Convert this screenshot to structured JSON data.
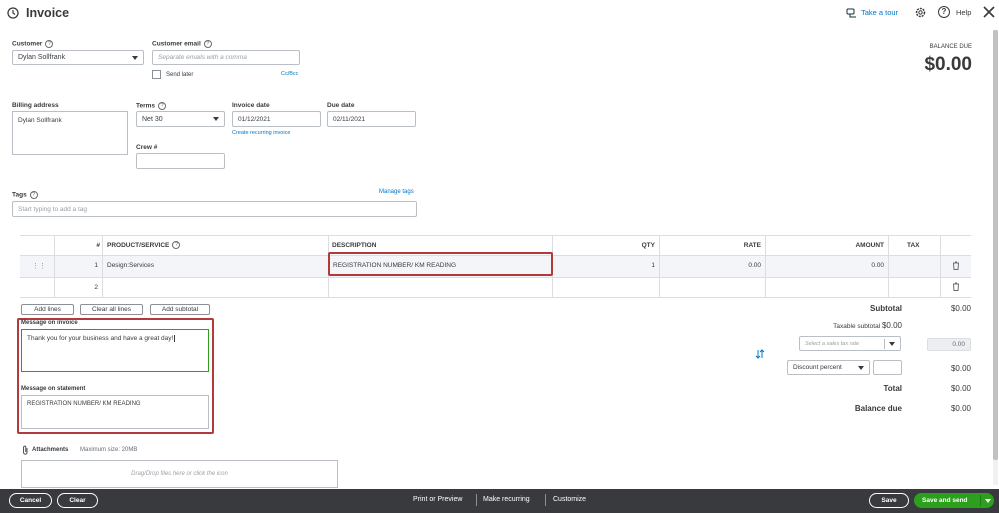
{
  "header": {
    "title": "Invoice",
    "take_tour": "Take a tour",
    "help": "Help"
  },
  "customer": {
    "label": "Customer",
    "value": "Dylan Sollfrank"
  },
  "email": {
    "label": "Customer email",
    "placeholder": "Separate emails with a comma",
    "send_later": "Send later",
    "cc_bcc": "Cc/Bcc"
  },
  "balance": {
    "label": "BALANCE DUE",
    "value": "$0.00"
  },
  "billing": {
    "label": "Billing address",
    "value": "Dylan Sollfrank"
  },
  "terms": {
    "label": "Terms",
    "value": "Net 30"
  },
  "invoice_date": {
    "label": "Invoice date",
    "value": "01/12/2021",
    "recurring_link": "Create recurring invoice"
  },
  "due_date": {
    "label": "Due date",
    "value": "02/11/2021"
  },
  "crew": {
    "label": "Crew #",
    "value": ""
  },
  "tags": {
    "label": "Tags",
    "manage": "Manage tags",
    "placeholder": "Start typing to add a tag"
  },
  "table": {
    "headers": {
      "num": "#",
      "product": "PRODUCT/SERVICE",
      "description": "DESCRIPTION",
      "qty": "QTY",
      "rate": "RATE",
      "amount": "AMOUNT",
      "tax": "TAX"
    },
    "rows": [
      {
        "num": "1",
        "product": "Design:Services",
        "description": "REGISTRATION NUMBER/ KM READING",
        "qty": "1",
        "rate": "0.00",
        "amount": "0.00"
      },
      {
        "num": "2",
        "product": "",
        "description": "",
        "qty": "",
        "rate": "",
        "amount": ""
      }
    ]
  },
  "line_buttons": {
    "add": "Add lines",
    "clear": "Clear all lines",
    "subtotal": "Add subtotal"
  },
  "message_invoice": {
    "label": "Message on invoice",
    "value": "Thank you for your business and have a great day!"
  },
  "message_statement": {
    "label": "Message on statement",
    "value": "REGISTRATION NUMBER/ KM READING"
  },
  "attachments": {
    "label": "Attachments",
    "max": "Maximum size: 20MB",
    "drop": "Drag/Drop files here or click the icon"
  },
  "totals": {
    "subtotal_label": "Subtotal",
    "subtotal": "$0.00",
    "taxable_label": "Taxable subtotal",
    "taxable": "$0.00",
    "tax_placeholder": "Select a sales tax rate",
    "tax_value": "0.00",
    "discount_label": "Discount percent",
    "discount": "$0.00",
    "total_label": "Total",
    "total": "$0.00",
    "balance_label": "Balance due",
    "balance": "$0.00"
  },
  "footer": {
    "cancel": "Cancel",
    "clear": "Clear",
    "print": "Print or Preview",
    "recurring": "Make recurring",
    "customize": "Customize",
    "save": "Save",
    "save_send": "Save and send"
  },
  "colors": {
    "accent": "#2ca01c",
    "link": "#0077c5",
    "footer": "#393a3d",
    "highlight": "#b23a3a"
  }
}
